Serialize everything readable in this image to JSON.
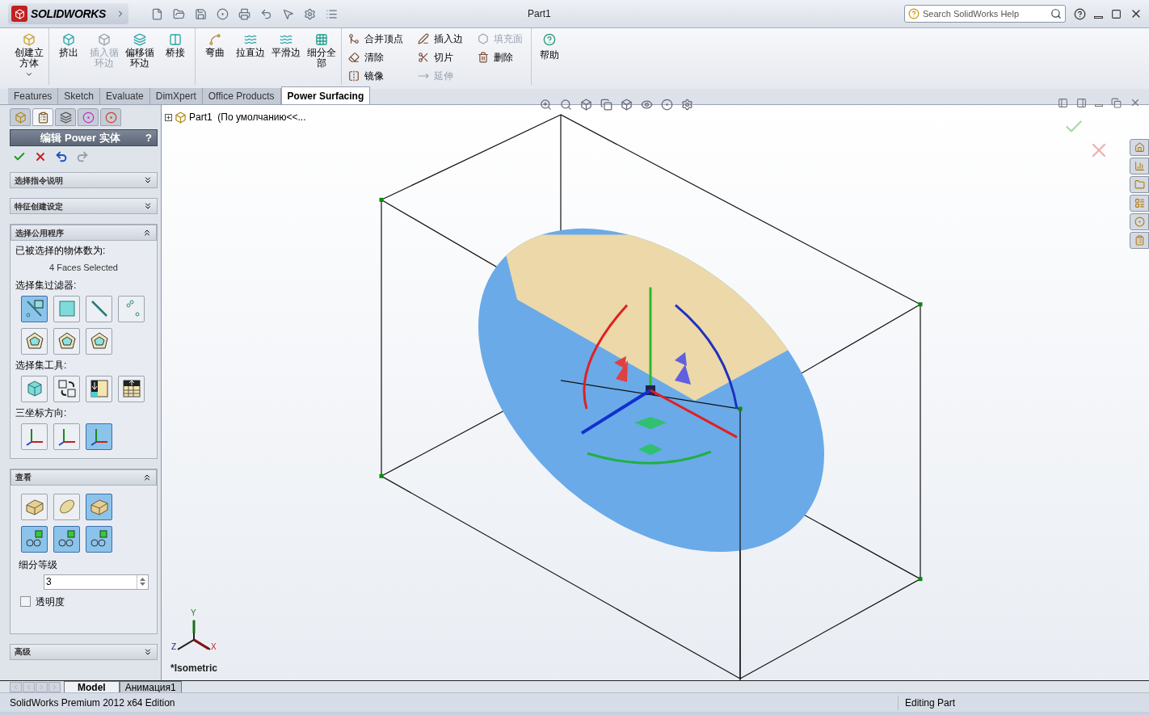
{
  "title_bar": {
    "logo": "SOLIDWORKS",
    "document_title": "Part1",
    "search": {
      "placeholder": "Search SolidWorks Help"
    }
  },
  "ribbon": {
    "tool_groups": [
      [
        {
          "label": "创建立方体",
          "disabled": false,
          "dropdown": true
        }
      ],
      [
        {
          "label": "挤出",
          "disabled": false,
          "dropdown": false
        },
        {
          "label": "插入循环边",
          "disabled": true,
          "dropdown": false
        },
        {
          "label": "偏移循环边",
          "disabled": false,
          "dropdown": false
        },
        {
          "label": "桥接",
          "disabled": false,
          "dropdown": false
        }
      ],
      [
        {
          "label": "弯曲",
          "disabled": false,
          "dropdown": false
        },
        {
          "label": "拉直边",
          "disabled": false,
          "dropdown": false
        },
        {
          "label": "平滑边",
          "disabled": false,
          "dropdown": false
        },
        {
          "label": "细分全部",
          "disabled": false,
          "dropdown": false
        }
      ]
    ],
    "small_tool_columns": [
      [
        {
          "label": "合并顶点",
          "disabled": false
        },
        {
          "label": "清除",
          "disabled": false
        },
        {
          "label": "镜像",
          "disabled": false
        }
      ],
      [
        {
          "label": "插入边",
          "disabled": false
        },
        {
          "label": "切片",
          "disabled": false
        },
        {
          "label": "延伸",
          "disabled": true
        }
      ],
      [
        {
          "label": "填充面",
          "disabled": true
        },
        {
          "label": "删除",
          "disabled": false
        }
      ]
    ],
    "help": {
      "label": "帮助"
    }
  },
  "command_tabs": [
    {
      "label": "Features",
      "selected": false
    },
    {
      "label": "Sketch",
      "selected": false
    },
    {
      "label": "Evaluate",
      "selected": false
    },
    {
      "label": "DimXpert",
      "selected": false
    },
    {
      "label": "Office Products",
      "selected": false
    },
    {
      "label": "Power Surfacing",
      "selected": true
    }
  ],
  "property_manager": {
    "panel_tabs": [
      {
        "selected": false
      },
      {
        "selected": true
      },
      {
        "selected": false
      },
      {
        "selected": false
      },
      {
        "selected": false
      }
    ],
    "title": "编辑 Power 实体",
    "help": "?",
    "actions": [
      {
        "kind": "ok",
        "disabled": false
      },
      {
        "kind": "cancel",
        "disabled": false
      },
      {
        "kind": "undo",
        "disabled": false
      },
      {
        "kind": "redo",
        "disabled": true
      }
    ],
    "sections": [
      {
        "title": "选择指令说明",
        "expanded": false
      },
      {
        "title": "特征创建设定",
        "expanded": false
      },
      {
        "title": "选择公用程序",
        "expanded": true,
        "kind": "selection",
        "count_label": "已被选择的物体数为:",
        "count_value": "4 Faces Selected",
        "groups": [
          {
            "label": "选择集过滤器:",
            "buttons": [
              {
                "kind": "face-edge",
                "selected": true
              },
              {
                "kind": "face",
                "selected": false
              },
              {
                "kind": "edge",
                "selected": false
              },
              {
                "kind": "vertex",
                "selected": false
              },
              {
                "kind": "loop",
                "selected": false
              },
              {
                "kind": "loop",
                "selected": false
              },
              {
                "kind": "loop",
                "selected": false
              }
            ]
          },
          {
            "label": "选择集工具:",
            "buttons": [
              {
                "kind": "cube",
                "selected": false
              },
              {
                "kind": "swap",
                "selected": false
              },
              {
                "kind": "grid-down",
                "selected": false
              },
              {
                "kind": "grid-up",
                "selected": false
              }
            ]
          },
          {
            "label": "三坐标方向:",
            "buttons": [
              {
                "kind": "triad",
                "selected": false
              },
              {
                "kind": "triad",
                "selected": false
              },
              {
                "kind": "triad",
                "selected": true
              }
            ]
          }
        ]
      },
      {
        "title": "查看",
        "expanded": true,
        "kind": "view",
        "buttons": [
          {
            "kind": "box",
            "selected": false
          },
          {
            "kind": "ellipsoid",
            "selected": false
          },
          {
            "kind": "box",
            "selected": true
          },
          {
            "kind": "glasses",
            "selected": true
          },
          {
            "kind": "glasses",
            "selected": true
          },
          {
            "kind": "glasses",
            "selected": true
          }
        ],
        "level_label": "细分等级",
        "level_value": "3",
        "transparency_label": "透明度",
        "transparency_checked": false
      },
      {
        "title": "高级",
        "expanded": false
      }
    ]
  },
  "feature_tree": {
    "label": "Part1  (По умолчанию<<...",
    "expanded": false
  },
  "viewport": {
    "view_name": "*Isometric",
    "triad_labels": [
      "Y",
      "Z",
      "X"
    ]
  },
  "bottom_tabs": [
    {
      "label": "Model",
      "selected": true
    },
    {
      "label": "Анимация1",
      "selected": false
    }
  ],
  "status_bar": {
    "product": "SolidWorks Premium 2012 x64 Edition",
    "mode": "Editing Part"
  }
}
